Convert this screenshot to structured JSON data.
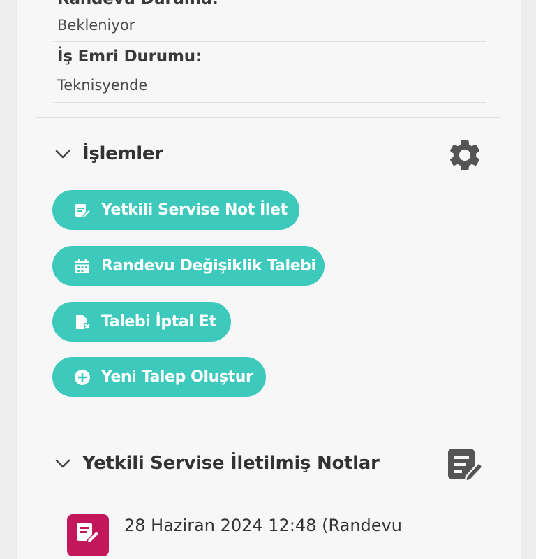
{
  "appointment": {
    "status_label": "Randevu Durumu:",
    "status_value": "Bekleniyor"
  },
  "work_order": {
    "status_label": "İş Emri Durumu:",
    "status_value": "Teknisyende"
  },
  "actions_section": {
    "title": "İşlemler",
    "settings_icon": "gear-icon",
    "buttons": [
      {
        "label": "Yetkili Servise Not İlet",
        "icon": "note-edit-icon"
      },
      {
        "label": "Randevu Değişiklik Talebi",
        "icon": "calendar-icon"
      },
      {
        "label": "Talebi İptal Et",
        "icon": "file-cancel-icon"
      },
      {
        "label": "Yeni Talep Oluştur",
        "icon": "plus-circle-icon"
      }
    ]
  },
  "notes_section": {
    "title": "Yetkili Servise İletilmiş Notlar",
    "icon": "note-edit-icon",
    "items": [
      {
        "text": "28 Haziran 2024 12:48   (Randevu"
      }
    ]
  },
  "colors": {
    "accent": "#3ec9bd",
    "note_badge": "#c2185b",
    "icon_gray": "#555555"
  }
}
